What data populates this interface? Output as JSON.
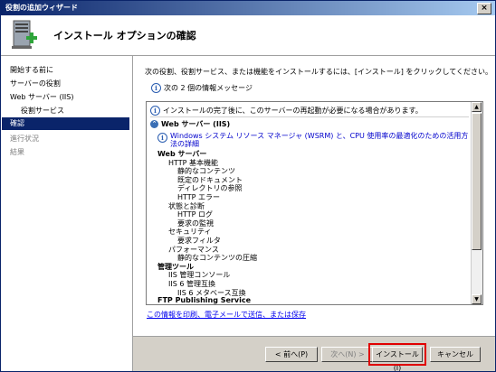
{
  "window": {
    "title": "役割の追加ウィザード",
    "close_label": "×"
  },
  "banner": {
    "title": "インストール オプションの確認",
    "icon": "server-add-icon"
  },
  "sidebar": {
    "items": [
      {
        "label": "開始する前に",
        "state": "normal"
      },
      {
        "label": "サーバーの役割",
        "state": "normal"
      },
      {
        "label": "Web サーバー (IIS)",
        "state": "normal"
      },
      {
        "label": "役割サービス",
        "state": "sub"
      },
      {
        "label": "確認",
        "state": "active"
      },
      {
        "label": "進行状況",
        "state": "dim"
      },
      {
        "label": "結果",
        "state": "dim"
      }
    ]
  },
  "main": {
    "intro": "次の役割、役割サービス、または機能をインストールするには、[インストール] をクリックしてください。",
    "message_count": "次の 2 個の情報メッセージ",
    "details": {
      "restart_note": "インストールの完了後に、このサーバーの再起動が必要になる場合があります。",
      "section_title": "Web サーバー (IIS)",
      "wsrm_link": "Windows システム リソース マネージャ (WSRM) と、CPU 使用率の最適化のための活用方法の詳細",
      "tree": [
        {
          "text": "Web サーバー",
          "level": 0,
          "bold": true
        },
        {
          "text": "HTTP 基本機能",
          "level": 1
        },
        {
          "text": "静的なコンテンツ",
          "level": 2
        },
        {
          "text": "既定のドキュメント",
          "level": 2
        },
        {
          "text": "ディレクトリの参照",
          "level": 2
        },
        {
          "text": "HTTP エラー",
          "level": 2
        },
        {
          "text": "状態と診断",
          "level": 1
        },
        {
          "text": "HTTP ログ",
          "level": 2
        },
        {
          "text": "要求の監視",
          "level": 2
        },
        {
          "text": "セキュリティ",
          "level": 1
        },
        {
          "text": "要求フィルタ",
          "level": 2
        },
        {
          "text": "パフォーマンス",
          "level": 1
        },
        {
          "text": "静的なコンテンツの圧縮",
          "level": 2
        },
        {
          "text": "管理ツール",
          "level": 0,
          "bold": true
        },
        {
          "text": "IIS 管理コンソール",
          "level": 1
        },
        {
          "text": "IIS 6 管理互換",
          "level": 1
        },
        {
          "text": "IIS 6 メタベース互換",
          "level": 2
        },
        {
          "text": "FTP Publishing Service",
          "level": 0,
          "bold": true
        }
      ]
    },
    "print_link": "この情報を印刷、電子メールで送信、または保存"
  },
  "footer": {
    "back_label": "< 前へ(P)",
    "next_label": "次へ(N) >",
    "install_label": "インストール(I)",
    "cancel_label": "キャンセル"
  },
  "colors": {
    "accent": "#0a246a",
    "link": "#0000ee",
    "focus": "#e00000"
  }
}
